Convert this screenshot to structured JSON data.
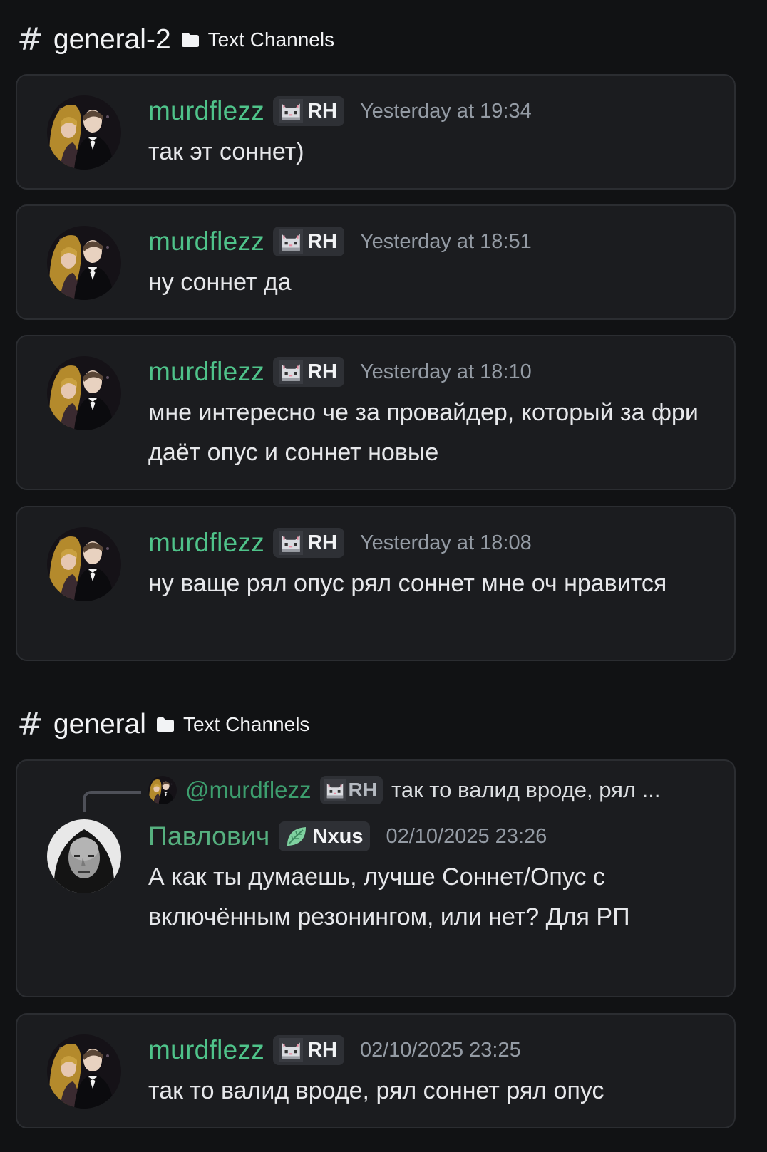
{
  "sections": [
    {
      "hash": "#",
      "channel": "general-2",
      "category": "Text Channels",
      "messages": [
        {
          "username": "murdflezz",
          "tag": "RH",
          "timestamp": "Yesterday at 19:34",
          "text": "так эт соннет)"
        },
        {
          "username": "murdflezz",
          "tag": "RH",
          "timestamp": "Yesterday at 18:51",
          "text": "ну соннет да"
        },
        {
          "username": "murdflezz",
          "tag": "RH",
          "timestamp": "Yesterday at 18:10",
          "text": "мне интересно че за провайдер, который за фри даёт опус и соннет новые"
        },
        {
          "username": "murdflezz",
          "tag": "RH",
          "timestamp": "Yesterday at 18:08",
          "text": "ну ваще рял опус рял соннет мне оч нравится"
        }
      ]
    },
    {
      "hash": "#",
      "channel": "general",
      "category": "Text Channels",
      "messages": [
        {
          "reply": {
            "mention": "@murdflezz",
            "tag": "RH",
            "text": "так то валид вроде, рял ..."
          },
          "username": "Павлович",
          "tag": "Nxus",
          "timestamp": "02/10/2025 23:26",
          "text": "А как ты думаешь, лучше Соннет/Опус с включённым резонингом, или нет? Для РП"
        },
        {
          "username": "murdflezz",
          "tag": "RH",
          "timestamp": "02/10/2025 23:25",
          "text": "так то валид вроде, рял соннет рял опус"
        }
      ]
    }
  ],
  "icons": {
    "folder": "folder-icon",
    "rh_tag": "pixel-cat-icon",
    "nxus_tag": "leaf-icon",
    "avatar_murdflezz": "avatar-couple-photo",
    "avatar_pavlovich": "avatar-bald-man-photo"
  },
  "colors": {
    "background": "#111214",
    "card": "#1b1c1f",
    "username_green": "#4fc38a",
    "timestamp": "#949ba4",
    "tag_bg": "#2e3035"
  }
}
